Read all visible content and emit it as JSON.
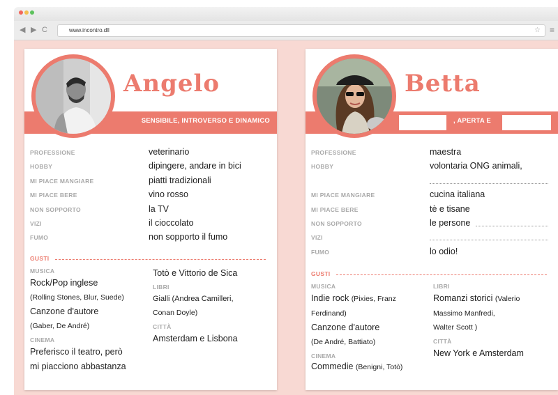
{
  "browser": {
    "url": "www.incontro.dll",
    "back_icon": "◀",
    "forward_icon": "▶",
    "reload_icon": "C",
    "star_icon": "☆",
    "menu_icon": "≡"
  },
  "colors": {
    "accent": "#ec7b6e",
    "background": "#f8d9d3",
    "label": "#a9a9a9"
  },
  "angelo": {
    "name": "Angelo",
    "tagline": "SENSIBILE, INTROVERSO E DINAMICO",
    "rows": [
      {
        "label": "PROFESSIONE",
        "value": "veterinario"
      },
      {
        "label": "HOBBY",
        "value": "dipingere, andare in bici"
      },
      {
        "label": "MI PIACE MANGIARE",
        "value": "piatti tradizionali"
      },
      {
        "label": "MI PIACE BERE",
        "value": "vino rosso"
      },
      {
        "label": "NON SOPPORTO",
        "value": "la TV"
      },
      {
        "label": "VIZI",
        "value": "il cioccolato"
      },
      {
        "label": "FUMO",
        "value": "non sopporto il fumo"
      }
    ],
    "gusti": "GUSTI",
    "musica_label": "MUSICA",
    "musica_1": "Rock/Pop inglese",
    "musica_1_detail": "(Rolling Stones, Blur, Suede)",
    "musica_2": "Canzone d'autore",
    "musica_2_detail": "(Gaber, De André)",
    "cinema_label": "CINEMA",
    "cinema_1": "Preferisco il teatro, però",
    "cinema_2": "mi piacciono abbastanza",
    "cinema_3": "Totò e Vittorio de Sica",
    "libri_label": "LIBRI",
    "libri_1": "Gialli (Andrea Camilleri,",
    "libri_2": "Conan Doyle)",
    "citta_label": "CITTÀ",
    "citta": "Amsterdam e Lisbona"
  },
  "betta": {
    "name": "Betta",
    "tagline_middle": ", APERTA E",
    "rows": [
      {
        "label": "PROFESSIONE",
        "value": "maestra"
      },
      {
        "label": "HOBBY",
        "value": "volontaria ONG animali,"
      },
      {
        "label": "",
        "value": ""
      },
      {
        "label": "MI PIACE MANGIARE",
        "value": "cucina italiana"
      },
      {
        "label": "MI PIACE BERE",
        "value": "tè e tisane"
      },
      {
        "label": "NON SOPPORTO",
        "value": "le persone"
      },
      {
        "label": "VIZI",
        "value": ""
      },
      {
        "label": "FUMO",
        "value": "lo odio!"
      }
    ],
    "gusti": "GUSTI",
    "musica_label": "MUSICA",
    "musica_1": "Indie rock",
    "musica_1_detail": "(Pixies, Franz",
    "musica_1_detail2": "Ferdinand)",
    "musica_2": "Canzone d'autore",
    "musica_2_detail": "(De André, Battiato)",
    "cinema_label": "CINEMA",
    "cinema_1": "Commedie",
    "cinema_1_detail": "(Benigni, Totò)",
    "libri_label": "LIBRI",
    "libri_1": "Romanzi storici",
    "libri_1_detail": "(Valerio",
    "libri_2": "Massimo Manfredi,",
    "libri_3": "Walter Scott )",
    "citta_label": "CITTÀ",
    "citta": "New York e Amsterdam"
  }
}
